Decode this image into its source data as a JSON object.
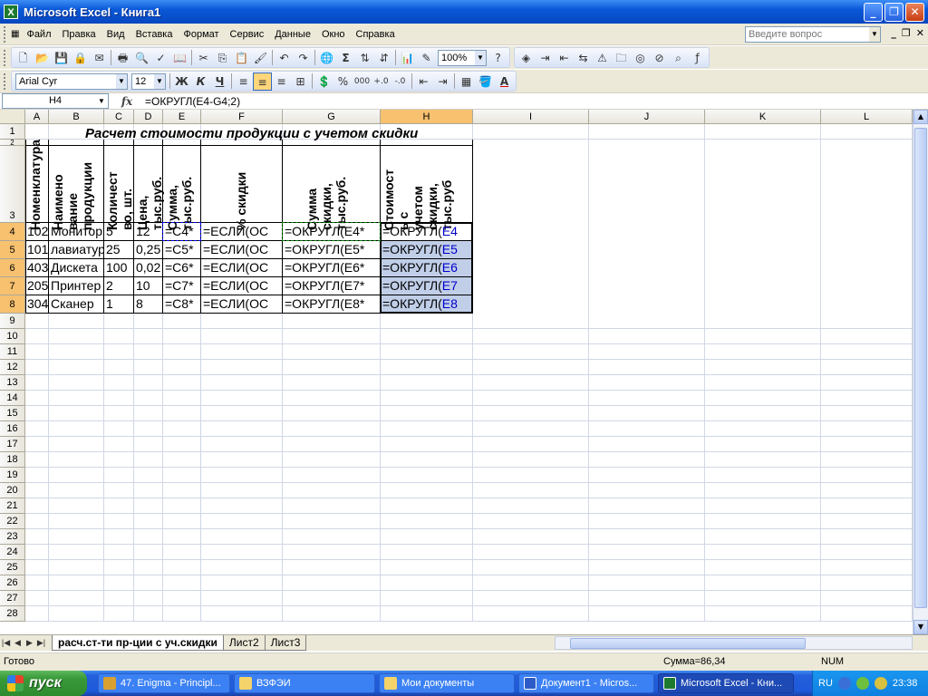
{
  "window": {
    "title": "Microsoft Excel - Книга1",
    "minimize": "_",
    "restore": "❐",
    "close": "✕"
  },
  "menu": {
    "items": [
      "Файл",
      "Правка",
      "Вид",
      "Вставка",
      "Формат",
      "Сервис",
      "Данные",
      "Окно",
      "Справка"
    ],
    "ask_placeholder": "Введите вопрос",
    "doc_min": "_",
    "doc_restore": "❐",
    "doc_close": "✕"
  },
  "toolbar": {
    "zoom": "100%"
  },
  "format": {
    "font": "Arial Cyr",
    "size": "12",
    "bold": "Ж",
    "italic": "К",
    "underline": "Ч",
    "percent": "%",
    "thousands": "000"
  },
  "formula_bar": {
    "name_box": "H4",
    "fx": "fx",
    "formula": "=ОКРУГЛ(E4-G4;2)"
  },
  "columns": [
    "A",
    "B",
    "C",
    "D",
    "E",
    "F",
    "G",
    "H",
    "I",
    "J",
    "K",
    "L"
  ],
  "rows": [
    "1",
    "2",
    "3",
    "4",
    "5",
    "6",
    "7",
    "8",
    "9",
    "10",
    "11",
    "12",
    "13",
    "14",
    "15",
    "16",
    "17",
    "18",
    "19",
    "20",
    "21",
    "22",
    "23",
    "24",
    "25",
    "26",
    "27",
    "28"
  ],
  "sheet": {
    "title": "Расчет стоимости продукции с учетом скидки",
    "headers": [
      "Номенклатура",
      "Наимено\nвание\nпродукции",
      "Количест\nво, шт.",
      "Цена,\nтыс.руб.",
      "Сумма,\nтыс.руб.",
      "% скидки",
      "Сумма\nскидки,\nтыс.руб.",
      "Стоимост\nь с\nучетом\nскидки,\nтыс.руб"
    ],
    "data": [
      [
        "102",
        "Монитор",
        "5",
        "12",
        "=C4*",
        "=ЕСЛИ(ОС",
        "=ОКРУГЛ(Е4*",
        "=ОКРУГЛ(Е4"
      ],
      [
        "101",
        "лавиатур",
        "25",
        "0,25",
        "=C5*",
        "=ЕСЛИ(ОС",
        "=ОКРУГЛ(Е5*",
        "=ОКРУГЛ(Е5"
      ],
      [
        "403",
        "Дискета",
        "100",
        "0,02",
        "=C6*",
        "=ЕСЛИ(ОС",
        "=ОКРУГЛ(Е6*",
        "=ОКРУГЛ(Е6"
      ],
      [
        "205",
        "Принтер",
        "2",
        "10",
        "=C7*",
        "=ЕСЛИ(ОС",
        "=ОКРУГЛ(Е7*",
        "=ОКРУГЛ(Е7"
      ],
      [
        "304",
        "Сканер",
        "1",
        "8",
        "=C8*",
        "=ЕСЛИ(ОС",
        "=ОКРУГЛ(Е8*",
        "=ОКРУГЛ(Е8"
      ]
    ]
  },
  "sheet_tabs": [
    "расч.ст-ти пр-ции с уч.скидки",
    "Лист2",
    "Лист3"
  ],
  "status": {
    "ready": "Готово",
    "sum": "Сумма=86,34",
    "num": "NUM"
  },
  "taskbar": {
    "start": "пуск",
    "tasks": [
      "47. Enigma - Principl...",
      "ВЗФЭИ",
      "Мои документы",
      "Документ1 - Micros...",
      "Microsoft Excel - Кни..."
    ],
    "lang": "RU",
    "clock": "23:38"
  },
  "colors": {
    "title_blue": "#0a58d8",
    "selection": "#c0cee8",
    "active_header": "#f7c170"
  }
}
